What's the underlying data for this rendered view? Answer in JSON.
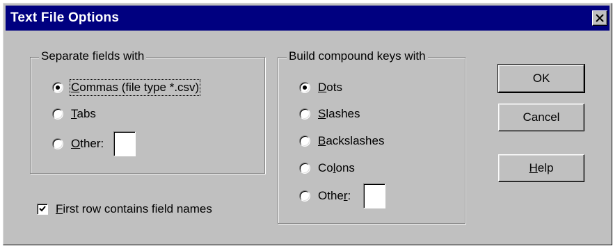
{
  "window": {
    "title": "Text File Options"
  },
  "separate_fields": {
    "legend": "Separate fields with",
    "options": [
      {
        "label_pre": "",
        "accel": "C",
        "label_post": "ommas (file type *.csv)",
        "checked": true
      },
      {
        "label_pre": "",
        "accel": "T",
        "label_post": "abs",
        "checked": false
      },
      {
        "label_pre": "",
        "accel": "O",
        "label_post": "ther:",
        "checked": false
      }
    ],
    "other_value": ""
  },
  "compound_keys": {
    "legend": "Build compound keys with",
    "options": [
      {
        "label_pre": "",
        "accel": "D",
        "label_post": "ots",
        "checked": true
      },
      {
        "label_pre": "",
        "accel": "S",
        "label_post": "lashes",
        "checked": false
      },
      {
        "label_pre": "",
        "accel": "B",
        "label_post": "ackslashes",
        "checked": false
      },
      {
        "label_pre": "Co",
        "accel": "l",
        "label_post": "ons",
        "checked": false
      },
      {
        "label_pre": "Othe",
        "accel": "r",
        "label_post": ":",
        "checked": false
      }
    ],
    "other_value": ""
  },
  "first_row": {
    "label_pre": "",
    "accel": "F",
    "label_post": "irst row contains field names",
    "checked": true
  },
  "buttons": {
    "ok": "OK",
    "cancel": "Cancel",
    "help_pre": "",
    "help_accel": "H",
    "help_post": "elp"
  }
}
